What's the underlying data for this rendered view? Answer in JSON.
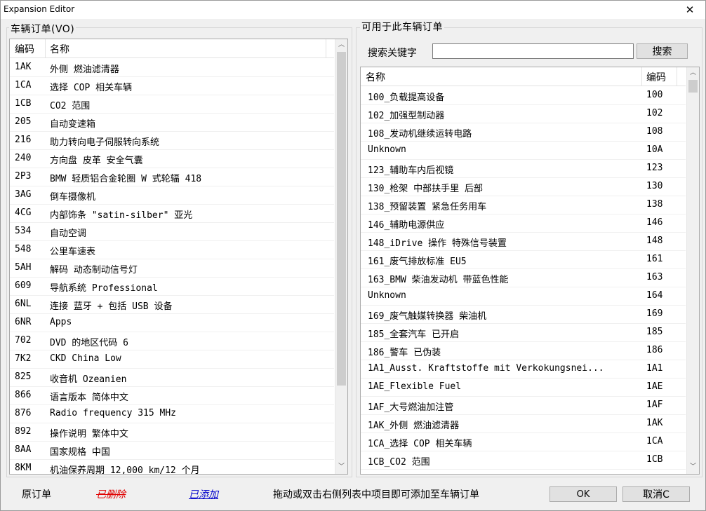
{
  "window": {
    "title": "Expansion Editor",
    "close_glyph": "✕"
  },
  "left": {
    "group_title": "车辆订单(VO)",
    "col_code": "编码",
    "col_name": "名称",
    "rows": [
      {
        "code": "1AK",
        "name": "外侧 燃油滤清器"
      },
      {
        "code": "1CA",
        "name": "选择 COP 相关车辆"
      },
      {
        "code": "1CB",
        "name": "CO2 范围"
      },
      {
        "code": "205",
        "name": "自动变速箱"
      },
      {
        "code": "216",
        "name": "助力转向电子伺服转向系统"
      },
      {
        "code": "240",
        "name": "方向盘 皮革 安全气囊"
      },
      {
        "code": "2P3",
        "name": "BMW 轻质铝合金轮圈 W 式轮辐 418"
      },
      {
        "code": "3AG",
        "name": "倒车摄像机"
      },
      {
        "code": "4CG",
        "name": "内部饰条 \"satin-silber\" 亚光"
      },
      {
        "code": "534",
        "name": "自动空调"
      },
      {
        "code": "548",
        "name": "公里车速表"
      },
      {
        "code": "5AH",
        "name": "解码 动态制动信号灯"
      },
      {
        "code": "609",
        "name": "导航系统 Professional"
      },
      {
        "code": "6NL",
        "name": "连接 蓝牙 + 包括 USB 设备"
      },
      {
        "code": "6NR",
        "name": "Apps"
      },
      {
        "code": "702",
        "name": "DVD 的地区代码 6"
      },
      {
        "code": "7K2",
        "name": "CKD China Low"
      },
      {
        "code": "825",
        "name": "收音机 Ozeanien"
      },
      {
        "code": "866",
        "name": "语言版本 简体中文"
      },
      {
        "code": "876",
        "name": "Radio frequency 315 MHz"
      },
      {
        "code": "892",
        "name": "操作说明 繁体中文"
      },
      {
        "code": "8AA",
        "name": "国家规格 中国"
      },
      {
        "code": "8KM",
        "name": "机油保养周期 12,000 km/12 个月"
      }
    ]
  },
  "right": {
    "group_title": "可用于此车辆订单",
    "search_label": "搜索关键字",
    "search_value": "",
    "search_button": "搜索",
    "col_name": "名称",
    "col_code": "编码",
    "rows": [
      {
        "name": "100_负载提高设备",
        "code": "100"
      },
      {
        "name": "102_加强型制动器",
        "code": "102"
      },
      {
        "name": "108_发动机继续运转电路",
        "code": "108"
      },
      {
        "name": "Unknown",
        "code": "10A"
      },
      {
        "name": "123_辅助车内后视镜",
        "code": "123"
      },
      {
        "name": "130_枪架 中部扶手里 后部",
        "code": "130"
      },
      {
        "name": "138_预留装置 紧急任务用车",
        "code": "138"
      },
      {
        "name": "146_辅助电源供应",
        "code": "146"
      },
      {
        "name": "148_iDrive 操作 特殊信号装置",
        "code": "148"
      },
      {
        "name": "161_废气排放标准 EU5",
        "code": "161"
      },
      {
        "name": "163_BMW 柴油发动机 带蓝色性能",
        "code": "163"
      },
      {
        "name": "Unknown",
        "code": "164"
      },
      {
        "name": "169_废气触媒转换器 柴油机",
        "code": "169"
      },
      {
        "name": "185_全套汽车 已开启",
        "code": "185"
      },
      {
        "name": "186_警车 已伪装",
        "code": "186"
      },
      {
        "name": "1A1_Ausst. Kraftstoffe mit Verkokungsnei...",
        "code": "1A1"
      },
      {
        "name": "1AE_Flexible Fuel",
        "code": "1AE"
      },
      {
        "name": "1AF_大号燃油加注管",
        "code": "1AF"
      },
      {
        "name": "1AK_外侧 燃油滤清器",
        "code": "1AK"
      },
      {
        "name": "1CA_选择 COP 相关车辆",
        "code": "1CA"
      },
      {
        "name": "1CB_CO2 范围",
        "code": "1CB"
      }
    ]
  },
  "footer": {
    "legend_original": "原订单",
    "legend_deleted": "已删除",
    "legend_added": "已添加",
    "hint": "拖动或双击右侧列表中项目即可添加至车辆订单",
    "ok": "OK",
    "cancel": "取消C"
  },
  "colors": {
    "deleted": "#e00000",
    "added": "#0000cc",
    "thumb": "#cdcdcd"
  }
}
